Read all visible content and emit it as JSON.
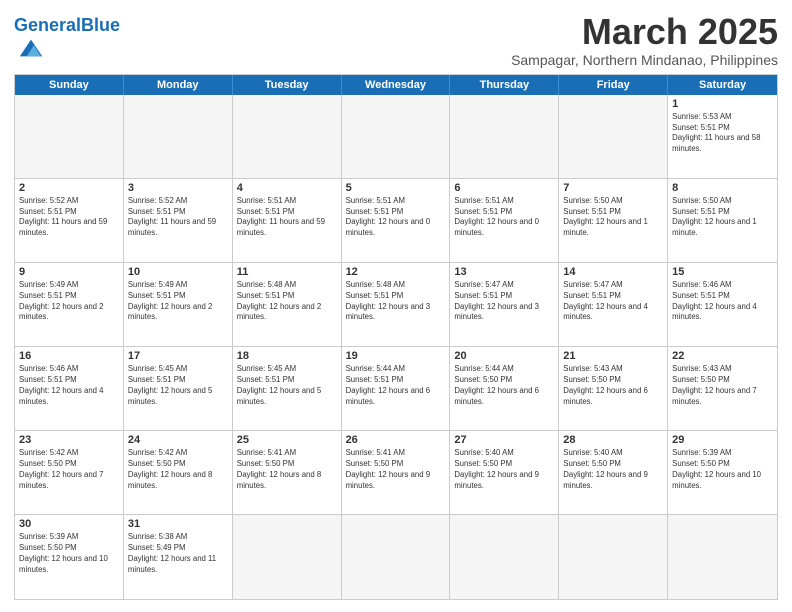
{
  "header": {
    "logo_general": "General",
    "logo_blue": "Blue",
    "month_title": "March 2025",
    "subtitle": "Sampagar, Northern Mindanao, Philippines"
  },
  "days": [
    "Sunday",
    "Monday",
    "Tuesday",
    "Wednesday",
    "Thursday",
    "Friday",
    "Saturday"
  ],
  "weeks": [
    [
      {
        "date": "",
        "empty": true
      },
      {
        "date": "",
        "empty": true
      },
      {
        "date": "",
        "empty": true
      },
      {
        "date": "",
        "empty": true
      },
      {
        "date": "",
        "empty": true
      },
      {
        "date": "",
        "empty": true
      },
      {
        "date": "1",
        "sunrise": "5:53 AM",
        "sunset": "5:51 PM",
        "daylight": "11 hours and 58 minutes."
      }
    ],
    [
      {
        "date": "2",
        "sunrise": "5:52 AM",
        "sunset": "5:51 PM",
        "daylight": "11 hours and 59 minutes."
      },
      {
        "date": "3",
        "sunrise": "5:52 AM",
        "sunset": "5:51 PM",
        "daylight": "11 hours and 59 minutes."
      },
      {
        "date": "4",
        "sunrise": "5:51 AM",
        "sunset": "5:51 PM",
        "daylight": "11 hours and 59 minutes."
      },
      {
        "date": "5",
        "sunrise": "5:51 AM",
        "sunset": "5:51 PM",
        "daylight": "12 hours and 0 minutes."
      },
      {
        "date": "6",
        "sunrise": "5:51 AM",
        "sunset": "5:51 PM",
        "daylight": "12 hours and 0 minutes."
      },
      {
        "date": "7",
        "sunrise": "5:50 AM",
        "sunset": "5:51 PM",
        "daylight": "12 hours and 1 minute."
      },
      {
        "date": "8",
        "sunrise": "5:50 AM",
        "sunset": "5:51 PM",
        "daylight": "12 hours and 1 minute."
      }
    ],
    [
      {
        "date": "9",
        "sunrise": "5:49 AM",
        "sunset": "5:51 PM",
        "daylight": "12 hours and 2 minutes."
      },
      {
        "date": "10",
        "sunrise": "5:49 AM",
        "sunset": "5:51 PM",
        "daylight": "12 hours and 2 minutes."
      },
      {
        "date": "11",
        "sunrise": "5:48 AM",
        "sunset": "5:51 PM",
        "daylight": "12 hours and 2 minutes."
      },
      {
        "date": "12",
        "sunrise": "5:48 AM",
        "sunset": "5:51 PM",
        "daylight": "12 hours and 3 minutes."
      },
      {
        "date": "13",
        "sunrise": "5:47 AM",
        "sunset": "5:51 PM",
        "daylight": "12 hours and 3 minutes."
      },
      {
        "date": "14",
        "sunrise": "5:47 AM",
        "sunset": "5:51 PM",
        "daylight": "12 hours and 4 minutes."
      },
      {
        "date": "15",
        "sunrise": "5:46 AM",
        "sunset": "5:51 PM",
        "daylight": "12 hours and 4 minutes."
      }
    ],
    [
      {
        "date": "16",
        "sunrise": "5:46 AM",
        "sunset": "5:51 PM",
        "daylight": "12 hours and 4 minutes."
      },
      {
        "date": "17",
        "sunrise": "5:45 AM",
        "sunset": "5:51 PM",
        "daylight": "12 hours and 5 minutes."
      },
      {
        "date": "18",
        "sunrise": "5:45 AM",
        "sunset": "5:51 PM",
        "daylight": "12 hours and 5 minutes."
      },
      {
        "date": "19",
        "sunrise": "5:44 AM",
        "sunset": "5:51 PM",
        "daylight": "12 hours and 6 minutes."
      },
      {
        "date": "20",
        "sunrise": "5:44 AM",
        "sunset": "5:50 PM",
        "daylight": "12 hours and 6 minutes."
      },
      {
        "date": "21",
        "sunrise": "5:43 AM",
        "sunset": "5:50 PM",
        "daylight": "12 hours and 6 minutes."
      },
      {
        "date": "22",
        "sunrise": "5:43 AM",
        "sunset": "5:50 PM",
        "daylight": "12 hours and 7 minutes."
      }
    ],
    [
      {
        "date": "23",
        "sunrise": "5:42 AM",
        "sunset": "5:50 PM",
        "daylight": "12 hours and 7 minutes."
      },
      {
        "date": "24",
        "sunrise": "5:42 AM",
        "sunset": "5:50 PM",
        "daylight": "12 hours and 8 minutes."
      },
      {
        "date": "25",
        "sunrise": "5:41 AM",
        "sunset": "5:50 PM",
        "daylight": "12 hours and 8 minutes."
      },
      {
        "date": "26",
        "sunrise": "5:41 AM",
        "sunset": "5:50 PM",
        "daylight": "12 hours and 9 minutes."
      },
      {
        "date": "27",
        "sunrise": "5:40 AM",
        "sunset": "5:50 PM",
        "daylight": "12 hours and 9 minutes."
      },
      {
        "date": "28",
        "sunrise": "5:40 AM",
        "sunset": "5:50 PM",
        "daylight": "12 hours and 9 minutes."
      },
      {
        "date": "29",
        "sunrise": "5:39 AM",
        "sunset": "5:50 PM",
        "daylight": "12 hours and 10 minutes."
      }
    ],
    [
      {
        "date": "30",
        "sunrise": "5:39 AM",
        "sunset": "5:50 PM",
        "daylight": "12 hours and 10 minutes."
      },
      {
        "date": "31",
        "sunrise": "5:38 AM",
        "sunset": "5:49 PM",
        "daylight": "12 hours and 11 minutes."
      },
      {
        "date": "",
        "empty": true
      },
      {
        "date": "",
        "empty": true
      },
      {
        "date": "",
        "empty": true
      },
      {
        "date": "",
        "empty": true
      },
      {
        "date": "",
        "empty": true
      }
    ]
  ]
}
